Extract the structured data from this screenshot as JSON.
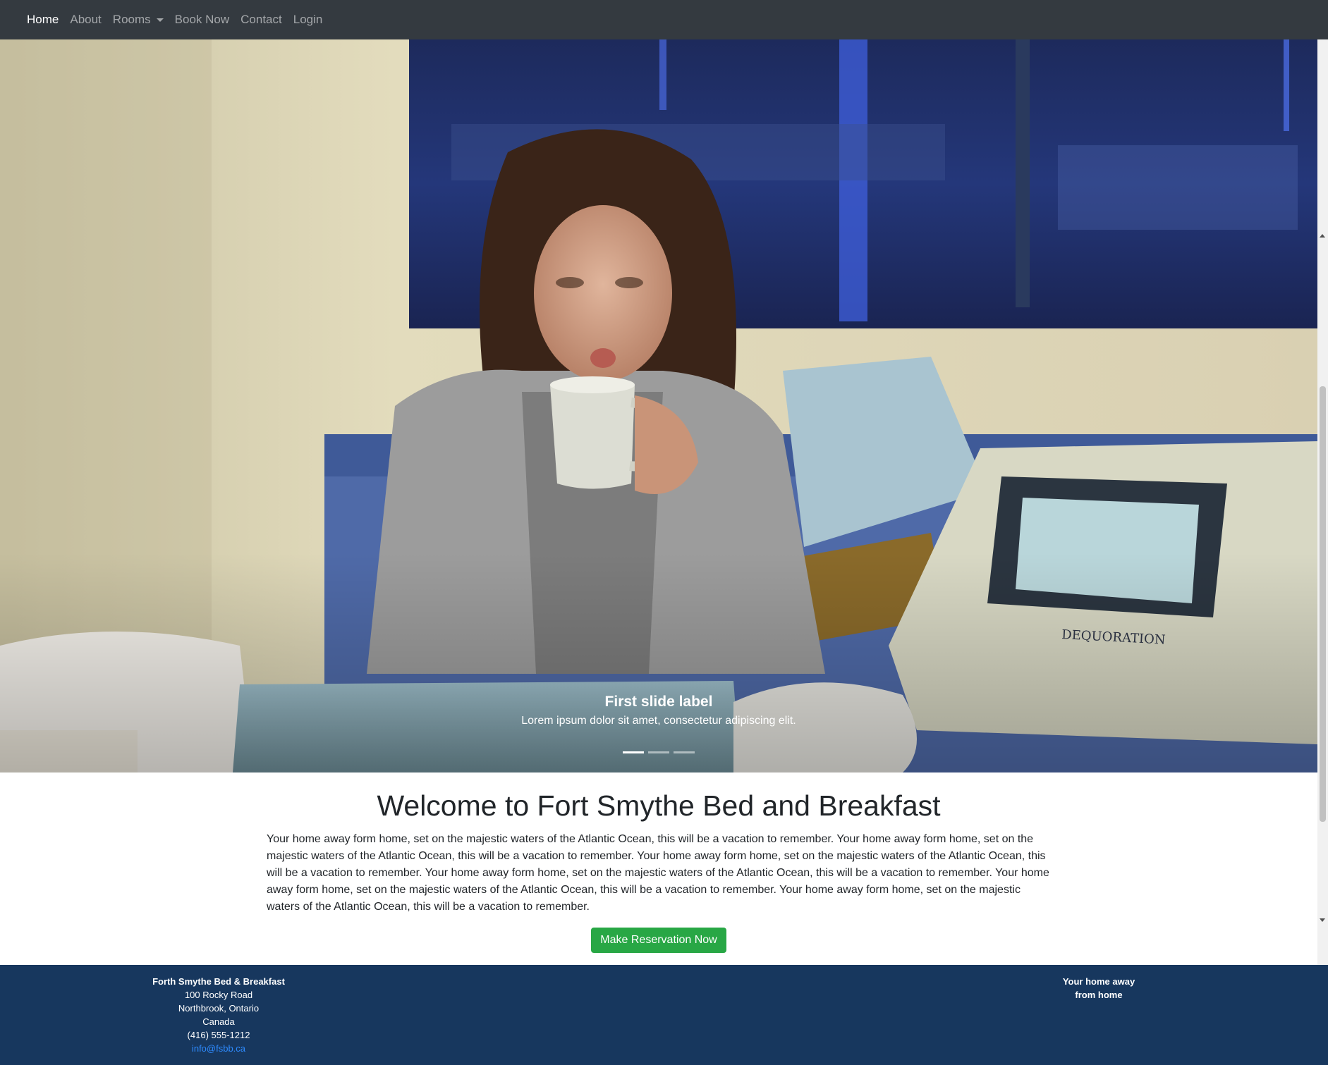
{
  "nav": {
    "items": [
      {
        "label": "Home",
        "active": true
      },
      {
        "label": "About",
        "active": false
      },
      {
        "label": "Rooms",
        "active": false,
        "dropdown": true
      },
      {
        "label": "Book Now",
        "active": false
      },
      {
        "label": "Contact",
        "active": false
      },
      {
        "label": "Login",
        "active": false
      }
    ]
  },
  "carousel": {
    "caption_title": "First slide label",
    "caption_text": "Lorem ipsum dolor sit amet, consectetur adipiscing elit.",
    "active_slide": 1,
    "slide_count": 3
  },
  "main": {
    "title": "Welcome to Fort Smythe Bed and Breakfast",
    "body": "Your home away form home, set on the majestic waters of the Atlantic Ocean, this will be a vacation to remember. Your home away form home, set on the majestic waters of the Atlantic Ocean, this will be a vacation to remember. Your home away form home, set on the majestic waters of the Atlantic Ocean, this will be a vacation to remember. Your home away form home, set on the majestic waters of the Atlantic Ocean, this will be a vacation to remember. Your home away form home, set on the majestic waters of the Atlantic Ocean, this will be a vacation to remember. Your home away form home, set on the majestic waters of the Atlantic Ocean, this will be a vacation to remember.",
    "button_label": "Make Reservation Now"
  },
  "footer": {
    "business_name": "Forth Smythe Bed & Breakfast",
    "address_line1": "100 Rocky Road",
    "address_line2": "Northbrook, Ontario",
    "country": "Canada",
    "phone": "(416) 555-1212",
    "email": "info@fsbb.ca",
    "tagline_line1": "Your home away",
    "tagline_line2": "from home"
  },
  "colors": {
    "navbar_bg": "#343a40",
    "footer_bg": "#17375e",
    "button_bg": "#28a745",
    "link": "#2e8bff"
  }
}
